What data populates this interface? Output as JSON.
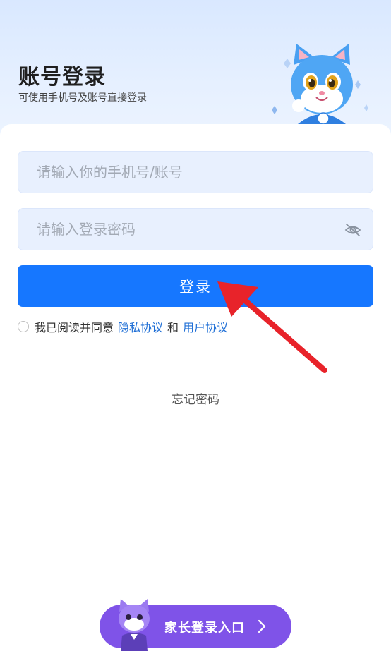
{
  "header": {
    "title": "账号登录",
    "subtitle": "可使用手机号及账号直接登录",
    "mascot_icon": "blue-cat-mascot-icon"
  },
  "form": {
    "account_placeholder": "请输入你的手机号/账号",
    "account_value": "",
    "password_placeholder": "请输入登录密码",
    "password_value": "",
    "password_visibility_icon": "eye-off-icon",
    "login_label": "登录"
  },
  "agreement": {
    "checked": false,
    "prefix": "我已阅读并同意",
    "privacy_link": "隐私协议",
    "conjunction": "和",
    "user_link": "用户协议"
  },
  "forgot_password": "忘记密码",
  "parent_entry": {
    "label": "家长登录入口",
    "mascot_icon": "purple-cat-mascot-icon",
    "chevron_icon": "chevron-right-icon"
  },
  "annotation": {
    "icon": "red-arrow-icon"
  },
  "colors": {
    "primary": "#1677ff",
    "link": "#1f6fd6",
    "input_bg": "#e8f0fe",
    "parent_button": "#7f53e8",
    "arrow": "#e8232a"
  }
}
